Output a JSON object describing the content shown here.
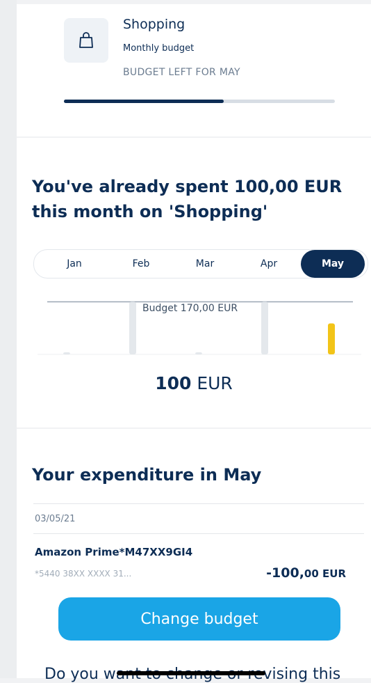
{
  "category": {
    "title": "Shopping",
    "subtitle": "Monthly budget",
    "budget_left_label": "BUDGET LEFT FOR MAY",
    "progress_fraction": 0.59,
    "icon": "shopping-bag-icon"
  },
  "spent": {
    "title": "You've already spent 100,00 EUR this month on 'Shopping'"
  },
  "months": [
    "Jan",
    "Feb",
    "Mar",
    "Apr",
    "May"
  ],
  "selected_month": "May",
  "chart_data": {
    "type": "bar",
    "categories": [
      "Jan",
      "Feb",
      "Mar",
      "Apr",
      "May"
    ],
    "values": [
      0,
      170,
      0,
      170,
      100
    ],
    "budget_label": "Budget 170,00 EUR",
    "budget_value": 170,
    "ylim": [
      0,
      180
    ],
    "colors": {
      "past": "#e4e8ec",
      "current": "#f2c418",
      "budget_line": "#9aa6b3"
    }
  },
  "amount": {
    "value": "100",
    "unit": "EUR"
  },
  "expenditure": {
    "title": "Your expenditure in May",
    "date": "03/05/21",
    "transactions": [
      {
        "name": "Amazon Prime*M47XX9GI4",
        "card": "*5440 38XX XXXX 31...",
        "amount_main": "-100,",
        "amount_cents": "00 EUR"
      }
    ]
  },
  "cta": {
    "label": "Change budget"
  },
  "bottom_text": "Do you want to change or revising this",
  "colors": {
    "navy": "#0d2d55",
    "accent": "#1aa5e6",
    "bar_current": "#f2c418"
  }
}
